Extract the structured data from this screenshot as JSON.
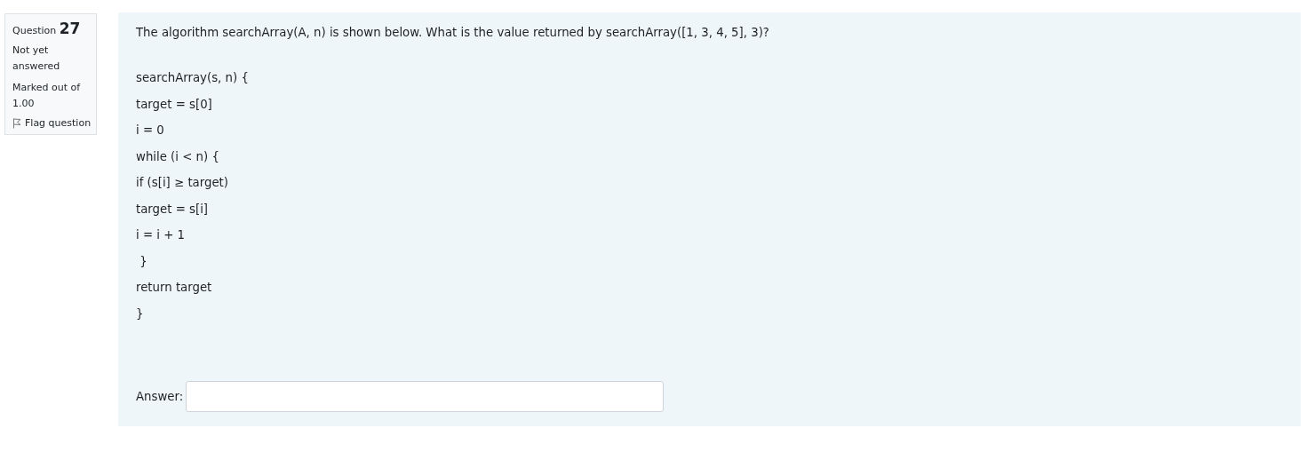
{
  "info": {
    "question_label": "Question",
    "question_number": "27",
    "status": "Not yet answered",
    "marks": "Marked out of 1.00",
    "flag": {
      "label": "Flag question",
      "flagged": false
    }
  },
  "question": {
    "prompt": "The algorithm searchArray(A, n) is shown below. What is the value returned by searchArray([1, 3, 4, 5], 3)?",
    "code": [
      "searchArray(s, n) {",
      "target = s[0]",
      "i = 0",
      "while (i < n) {",
      "if (s[i] ≥ target)",
      "target = s[i]",
      "i = i + 1",
      " }",
      "return target",
      "}"
    ],
    "answer": {
      "label": "Answer:"
    }
  }
}
